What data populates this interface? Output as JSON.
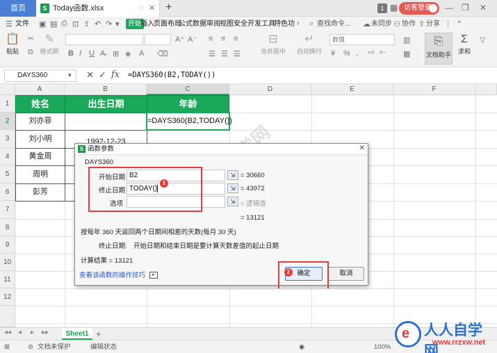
{
  "titlebar": {
    "home_tab": "首页",
    "file_tab": "Today函数.xlsx",
    "file_badge": "S",
    "window_count": "1",
    "login_label": "访客登录"
  },
  "menu": {
    "file": "文件",
    "tabs": [
      "开始",
      "插入",
      "页面布局",
      "公式",
      "数据",
      "审阅",
      "视图",
      "安全",
      "开发工具",
      "特色功"
    ],
    "search": "查找命令...",
    "sync": "未同步",
    "collab": "协作",
    "share": "分享"
  },
  "ribbon": {
    "paste": "粘贴",
    "format_painter": "格式刷",
    "merge_center": "合并居中",
    "wrap": "自动换行",
    "number_format": "数值",
    "doc_assistant": "文档助手",
    "sum_symbol": "Σ",
    "sum_label": "求和"
  },
  "formula_bar": {
    "name_box": "DAYS360",
    "cancel": "✕",
    "confirm": "✓",
    "fx": "fx",
    "formula": "=DAYS360(B2,TODAY())"
  },
  "grid": {
    "columns": [
      "A",
      "B",
      "C",
      "D",
      "E",
      "F"
    ],
    "rows": [
      "1",
      "2",
      "3",
      "4",
      "5",
      "6",
      "7",
      "8",
      "9",
      "10",
      "11",
      "12"
    ],
    "header_row": [
      "姓名",
      "出生日期",
      "年龄"
    ],
    "names": [
      "刘亦菲",
      "刘小明",
      "黄金周",
      "周明",
      "彭芳"
    ],
    "b3": "1992-12-23",
    "c2_formula": "=DAYS360(B2,TODAY())"
  },
  "dialog": {
    "title": "函数参数",
    "badge": "S",
    "function_name": "DAYS360",
    "arg1_label": "开始日期",
    "arg1_value": "B2",
    "arg1_result": "= 30660",
    "arg2_label": "终止日期",
    "arg2_value": "TODAY()",
    "arg2_result": "= 43972",
    "arg3_label": "选项",
    "arg3_value": "",
    "arg3_result": "= 逻辑值",
    "result_top": "= 13121",
    "description": "按每年 360 天返回两个日期间相差的天数(每月 30 天)",
    "param_desc_label": "终止日期:",
    "param_desc": "开始日期和结束日期是要计算天数差值的起止日期",
    "calc_result": "计算结果 = 13121",
    "help_link": "查看该函数的操作技巧",
    "ok": "确定",
    "cancel": "取消",
    "marker1": "1",
    "marker2": "2"
  },
  "sheets": {
    "nav": [
      "◂◂",
      "◂",
      "▸",
      "▸▸"
    ],
    "active": "Sheet1",
    "add": "+"
  },
  "status": {
    "protect": "文档未保护",
    "mode": "编辑状态",
    "zoom": "100%"
  },
  "watermark": {
    "site_name": "人人自学网",
    "site_url": "www.rrzxw.net",
    "diagonal_text": "软件自学网",
    "diagonal_url": "WWW.RJZXW.COM",
    "logo_glyph": "e"
  },
  "colors": {
    "accent_green": "#1aa85a",
    "highlight_red": "#e53b3b",
    "home_tab_blue": "#4a7fd4",
    "login_red": "#e25a52"
  }
}
